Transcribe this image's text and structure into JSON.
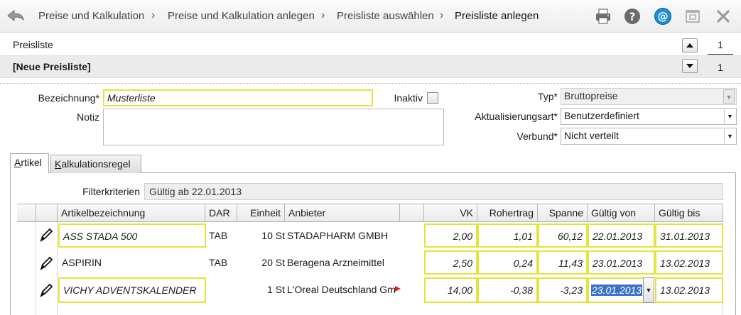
{
  "breadcrumb": [
    "Preise und Kalkulation",
    "Preise und Kalkulation anlegen",
    "Preisliste auswählen",
    "Preisliste anlegen"
  ],
  "breadcrumb_separator": "›",
  "toolbar": {
    "print_icon": "printer-icon",
    "help_icon": "help-icon",
    "email_icon": "at-sign-icon",
    "window_icon": "window-icon",
    "close_icon": "close-icon"
  },
  "preisliste": {
    "label": "Preisliste",
    "title": "[Neue Preisliste]",
    "page_top": "1",
    "page_bottom": "1"
  },
  "form": {
    "bezeichnung_label": "Bezeichnung*",
    "bezeichnung_value": "Musterliste",
    "notiz_label": "Notiz",
    "notiz_value": "",
    "inaktiv_label": "Inaktiv",
    "typ_label": "Typ*",
    "typ_value": "Bruttopreise",
    "aktualisierungsart_label": "Aktualisierungsart*",
    "aktualisierungsart_value": "Benutzerdefiniert",
    "verbund_label": "Verbund*",
    "verbund_value": "Nicht verteilt"
  },
  "tabs": [
    {
      "first": "A",
      "rest": "rtikel"
    },
    {
      "first": "K",
      "rest": "alkulationsregel"
    }
  ],
  "filter": {
    "label": "Filterkriterien",
    "value": "Gültig ab 22.01.2013"
  },
  "columns": [
    "Artikelbezeichnung",
    "DAR",
    "Einheit",
    "Anbieter",
    "VK",
    "Rohertrag",
    "Spanne",
    "Gültig von",
    "Gültig bis"
  ],
  "rows": [
    {
      "name": "ASS STADA 500",
      "dar": "TAB",
      "einheit": "10 St",
      "anbieter": "STADAPHARM GMBH",
      "vk": "2,00",
      "rohertrag": "1,01",
      "spanne": "60,12",
      "von": "22.01.2013",
      "bis": "31.01.2013"
    },
    {
      "name": "ASPIRIN",
      "dar": "TAB",
      "einheit": "20 St",
      "anbieter": "Beragena Arzneimittel",
      "vk": "2,50",
      "rohertrag": "0,24",
      "spanne": "11,43",
      "von": "23.01.2013",
      "bis": "13.02.2013"
    },
    {
      "name": "VICHY ADVENTSKALENDER",
      "dar": "",
      "einheit": "1 St",
      "anbieter": "L'Oreal Deutschland Gm",
      "vk": "14,00",
      "rohertrag": "-0,38",
      "spanne": "-3,23",
      "von": "23.01.2013",
      "bis": "13.02.2013"
    }
  ],
  "colors": {
    "highlight_border": "#e4e43a",
    "selection": "#3b73c8",
    "band": "#ebebeb"
  }
}
